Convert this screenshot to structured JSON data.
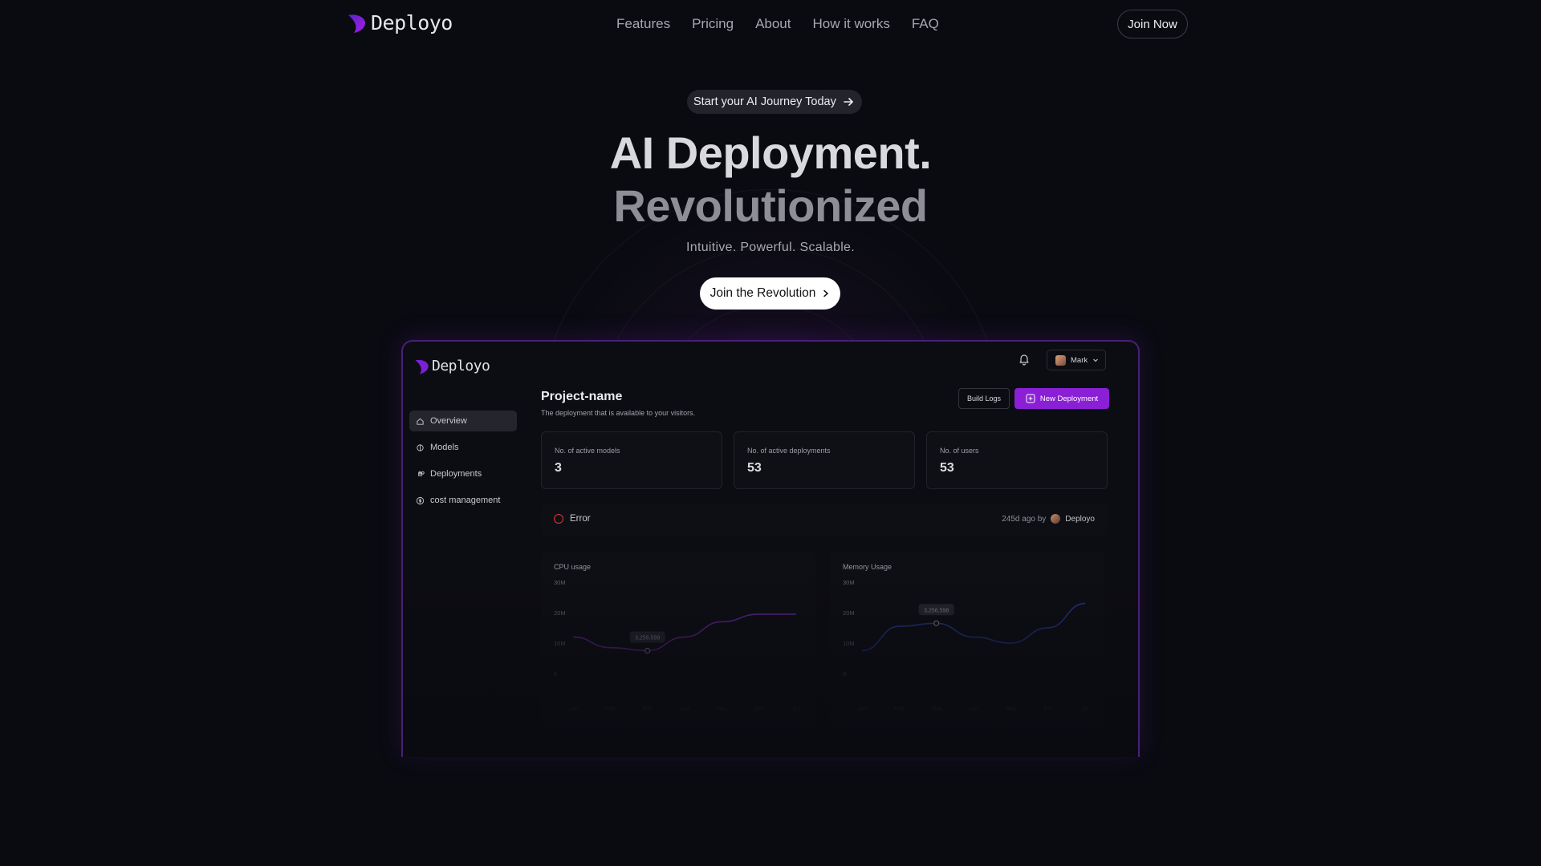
{
  "nav": {
    "brand": "Deployo",
    "links": [
      "Features",
      "Pricing",
      "About",
      "How it works",
      "FAQ"
    ],
    "cta": "Join Now"
  },
  "hero": {
    "pill": "Start your AI Journey Today",
    "title_line1": "AI Deployment.",
    "title_line2": "Revolutionized",
    "subtitle": "Intuitive. Powerful. Scalable.",
    "cta": "Join the Revolution"
  },
  "dashboard": {
    "brand": "Deployo",
    "user": "Mark",
    "sidebar": [
      {
        "label": "Overview",
        "icon": "home-icon",
        "active": true
      },
      {
        "label": "Models",
        "icon": "brain-icon",
        "active": false
      },
      {
        "label": "Deployments",
        "icon": "command-icon",
        "active": false
      },
      {
        "label": "cost management",
        "icon": "dollar-icon",
        "active": false
      }
    ],
    "project_title": "Project-name",
    "project_subtitle": "The deployment that is available to your visitors.",
    "build_logs": "Build Logs",
    "new_deployment": "New Deployment",
    "stats": [
      {
        "label": "No. of active models",
        "value": "3"
      },
      {
        "label": "No. of active deployments",
        "value": "53"
      },
      {
        "label": "No. of users",
        "value": "53"
      }
    ],
    "status": {
      "label": "Error",
      "time": "245d ago by",
      "author": "Deployo"
    },
    "accent": "#8b1fd6"
  },
  "chart_data": [
    {
      "type": "line",
      "title": "CPU usage",
      "x": [
        "Jan",
        "Feb",
        "Mar",
        "Apr",
        "May",
        "Jun",
        "Jul"
      ],
      "yticks": [
        "30M",
        "20M",
        "10M",
        "0"
      ],
      "ylim": [
        0,
        30000000
      ],
      "series": [
        {
          "values": [
            12000000,
            8500000,
            7500000,
            12000000,
            17000000,
            19500000,
            19500000
          ]
        }
      ],
      "tooltip": "3,256,598",
      "color": "#6e2aa6"
    },
    {
      "type": "line",
      "title": "Memory Usage",
      "x": [
        "Jan",
        "Feb",
        "Mar",
        "Apr",
        "May",
        "Jun",
        "Jul"
      ],
      "yticks": [
        "30M",
        "20M",
        "10M",
        "0"
      ],
      "ylim": [
        0,
        30000000
      ],
      "series": [
        {
          "values": [
            7500000,
            15500000,
            16500000,
            12000000,
            10000000,
            15000000,
            23000000
          ]
        }
      ],
      "tooltip": "3,256,598",
      "color": "#2b3a9a"
    }
  ]
}
